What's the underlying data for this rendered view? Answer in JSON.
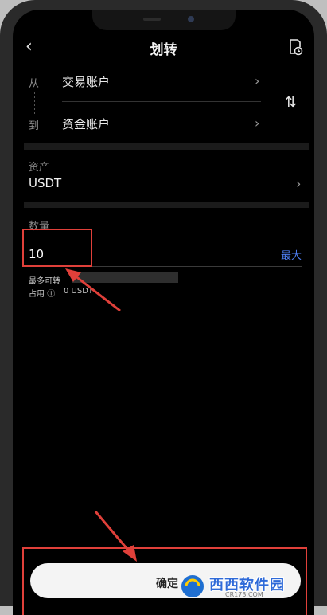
{
  "header": {
    "title": "划转"
  },
  "transfer": {
    "from_label": "从",
    "to_label": "到",
    "from_account": "交易账户",
    "to_account": "资金账户"
  },
  "asset": {
    "label": "资产",
    "value": "USDT"
  },
  "quantity": {
    "label": "数量",
    "value": "10",
    "max_label": "最大"
  },
  "info": {
    "max_transfer_label": "最多可转",
    "occupied_label": "占用",
    "occupied_value": "0 USDT"
  },
  "footer": {
    "confirm_label": "确定"
  },
  "watermark": {
    "text": "西西软件园",
    "sub": "CR173.COM"
  },
  "colors": {
    "accent": "#4d7df0",
    "highlight": "#e0403a"
  }
}
